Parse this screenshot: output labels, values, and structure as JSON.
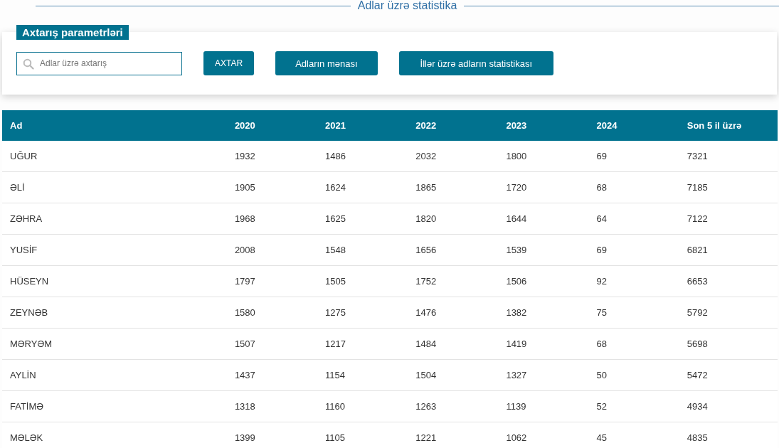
{
  "page_title": "Adlar üzrə statistika",
  "search_panel": {
    "legend": "Axtarış parametrləri",
    "search": {
      "placeholder": "Adlar üzrə axtarış"
    },
    "buttons": [
      "AXTAR",
      "Adların mənası",
      "İllər üzrə adların statistikası"
    ]
  },
  "table": {
    "columns": [
      "Ad",
      "2020",
      "2021",
      "2022",
      "2023",
      "2024",
      "Son 5 il üzrə"
    ],
    "rows": [
      [
        "UĞUR",
        "1932",
        "1486",
        "2032",
        "1800",
        "69",
        "7321"
      ],
      [
        "ƏLİ",
        "1905",
        "1624",
        "1865",
        "1720",
        "68",
        "7185"
      ],
      [
        "ZƏHRA",
        "1968",
        "1625",
        "1820",
        "1644",
        "64",
        "7122"
      ],
      [
        "YUSİF",
        "2008",
        "1548",
        "1656",
        "1539",
        "69",
        "6821"
      ],
      [
        "HÜSEYN",
        "1797",
        "1505",
        "1752",
        "1506",
        "92",
        "6653"
      ],
      [
        "ZEYNƏB",
        "1580",
        "1275",
        "1476",
        "1382",
        "75",
        "5792"
      ],
      [
        "MƏRYƏM",
        "1507",
        "1217",
        "1484",
        "1419",
        "68",
        "5698"
      ],
      [
        "AYLİN",
        "1437",
        "1154",
        "1504",
        "1327",
        "50",
        "5472"
      ],
      [
        "FATİMƏ",
        "1318",
        "1160",
        "1263",
        "1139",
        "52",
        "4934"
      ],
      [
        "MƏLƏK",
        "1399",
        "1105",
        "1221",
        "1062",
        "45",
        "4835"
      ]
    ]
  }
}
